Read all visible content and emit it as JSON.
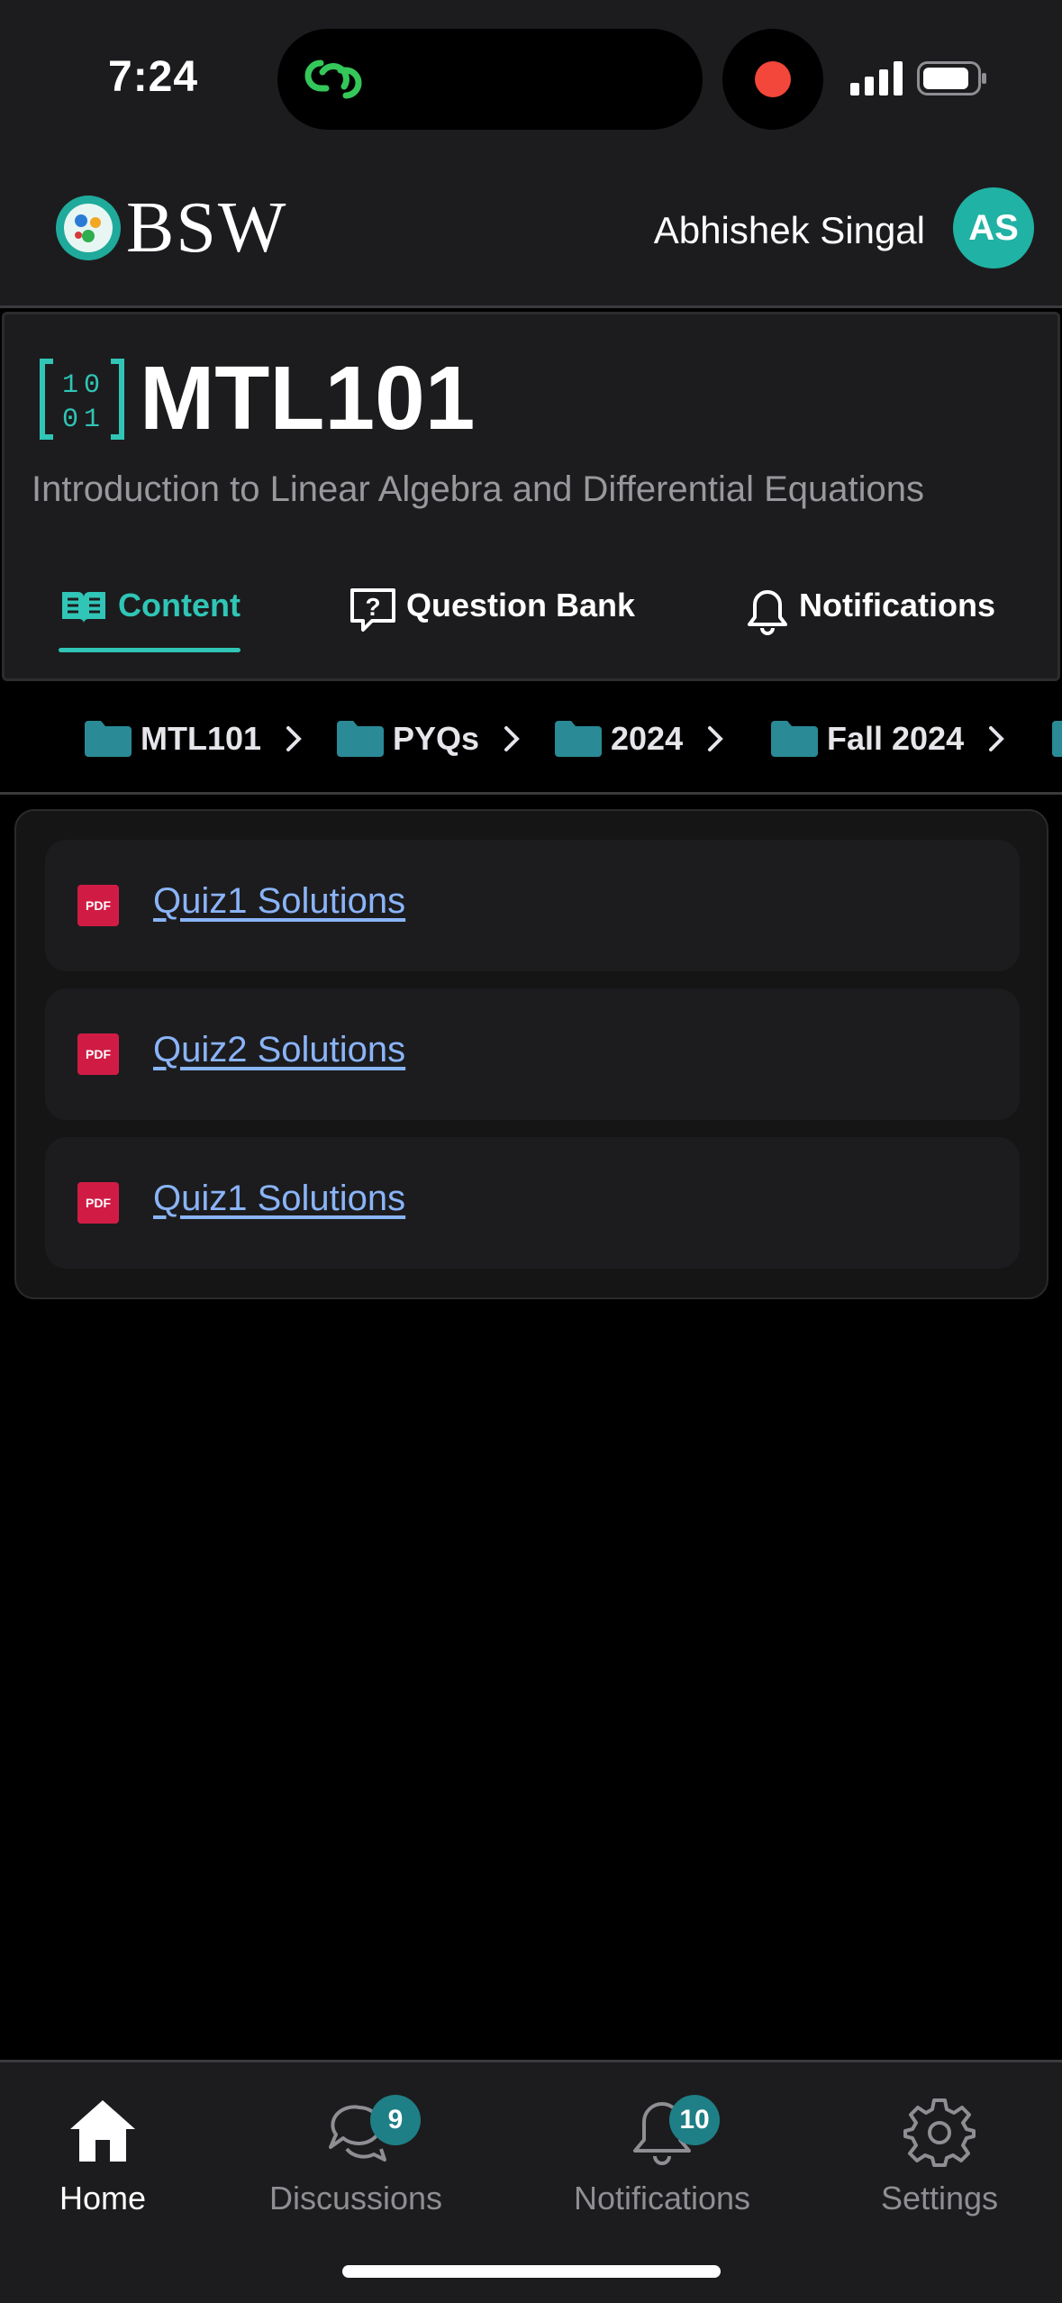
{
  "status_bar": {
    "time": "7:24",
    "island_icon": "link-rings-icon",
    "indicators": [
      "recording-dot-icon",
      "signal-bars-icon",
      "battery-icon"
    ]
  },
  "header": {
    "logo_text": "BSW",
    "user_name": "Abhishek Singal",
    "avatar_initials": "AS"
  },
  "course": {
    "code": "MTL101",
    "name": "Introduction to Linear Algebra and Differential Equations",
    "icon_digits": [
      "1",
      "0",
      "0",
      "1"
    ],
    "tabs": [
      {
        "label": "Content",
        "icon": "open-book-icon",
        "active": true
      },
      {
        "label": "Question Bank",
        "icon": "question-bubble-icon",
        "active": false
      },
      {
        "label": "Notifications",
        "icon": "bell-icon",
        "active": false
      }
    ]
  },
  "breadcrumb": {
    "items": [
      "MTL101",
      "PYQs",
      "2024",
      "Fall 2024"
    ]
  },
  "files": [
    {
      "name": "Quiz1 Solutions",
      "type": "PDF"
    },
    {
      "name": "Quiz2 Solutions",
      "type": "PDF"
    },
    {
      "name": "Quiz1 Solutions",
      "type": "PDF"
    }
  ],
  "bottom_nav": [
    {
      "label": "Home",
      "icon": "home-icon",
      "active": true
    },
    {
      "label": "Discussions",
      "icon": "chat-bubbles-icon",
      "badge": "9"
    },
    {
      "label": "Notifications",
      "icon": "bell-icon",
      "badge": "10"
    },
    {
      "label": "Settings",
      "icon": "gear-icon"
    }
  ],
  "colors": {
    "accent": "#30c5b6",
    "badge": "#1f7f86",
    "link": "#8ab4f8",
    "pdf": "#d01c45",
    "folder": "#2a8a96"
  }
}
